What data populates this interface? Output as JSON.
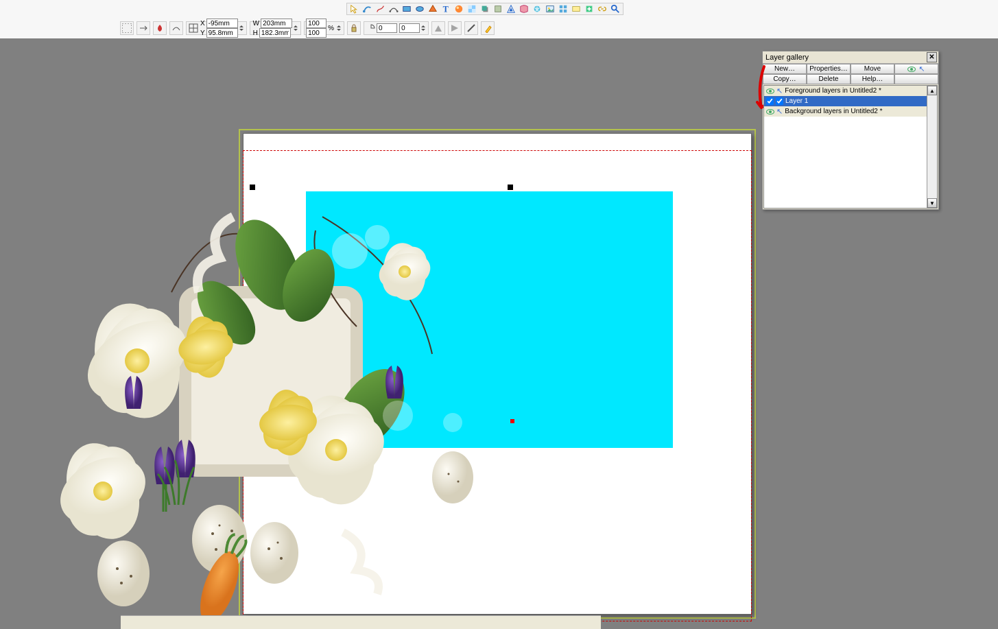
{
  "toolbar_icons": [
    "selector",
    "shape-editor",
    "freehand",
    "bezier",
    "rectangle",
    "ellipse",
    "quickshape",
    "text",
    "fill",
    "transparency",
    "shadow",
    "bevel",
    "contour",
    "mould",
    "liveeffect",
    "photo",
    "clipart",
    "bitmap",
    "export",
    "link",
    "zoom"
  ],
  "propbar": {
    "x": "-95mm",
    "y": "95.8mm",
    "w": "203mm",
    "h": "182.3mm",
    "scale_x": "100",
    "scale_y": "100",
    "angle": "0",
    "skew": "0"
  },
  "layer_gallery": {
    "title": "Layer gallery",
    "buttons": {
      "new": "New…",
      "properties": "Properties…",
      "move": "Move",
      "copy": "Copy…",
      "delete": "Delete",
      "help": "Help…"
    },
    "rows": {
      "fg": "Foreground layers in Untitled2 *",
      "layer1": "Layer 1",
      "bg": "Background layers in Untitled2 *"
    }
  }
}
